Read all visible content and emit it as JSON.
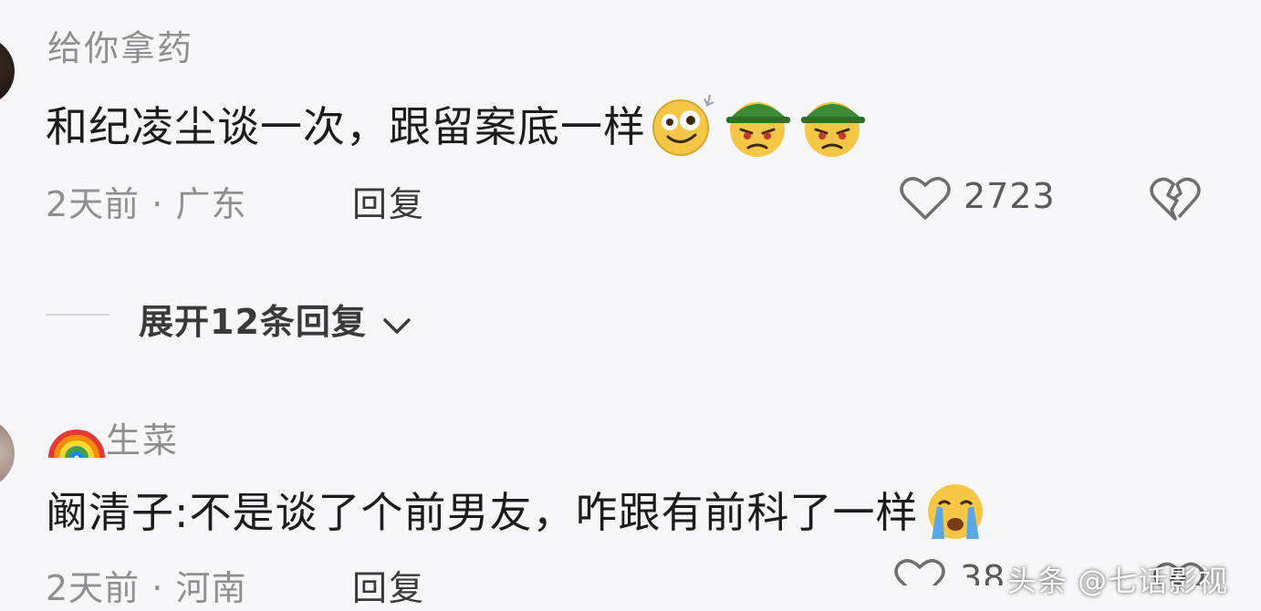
{
  "comments": [
    {
      "username": "给你拿药",
      "text": "和纪凌尘谈一次，跟留案底一样",
      "emojis": [
        "dizzy-face-emoji",
        "army-helmet-angry-emoji",
        "army-helmet-angry-emoji"
      ],
      "time": "2天前",
      "separator": "·",
      "location": "广东",
      "reply_label": "回复",
      "like_count": "2723"
    },
    {
      "username_prefix_icon": "rainbow-icon",
      "username": "生菜",
      "text": "阚清子:不是谈了个前男友，咋跟有前科了一样",
      "emojis": [
        "loudly-crying-face-emoji"
      ],
      "time": "2天前",
      "separator": "·",
      "location": "河南",
      "reply_label": "回复",
      "like_count_partial": "38"
    }
  ],
  "expand_replies": {
    "label": "展开12条回复",
    "icon": "chevron-down-icon"
  },
  "watermark": {
    "text": "头条 @七话影视"
  },
  "colors": {
    "background": "#f7f7f9",
    "text_primary": "#1c1c1e",
    "text_secondary": "#8e8e93"
  }
}
